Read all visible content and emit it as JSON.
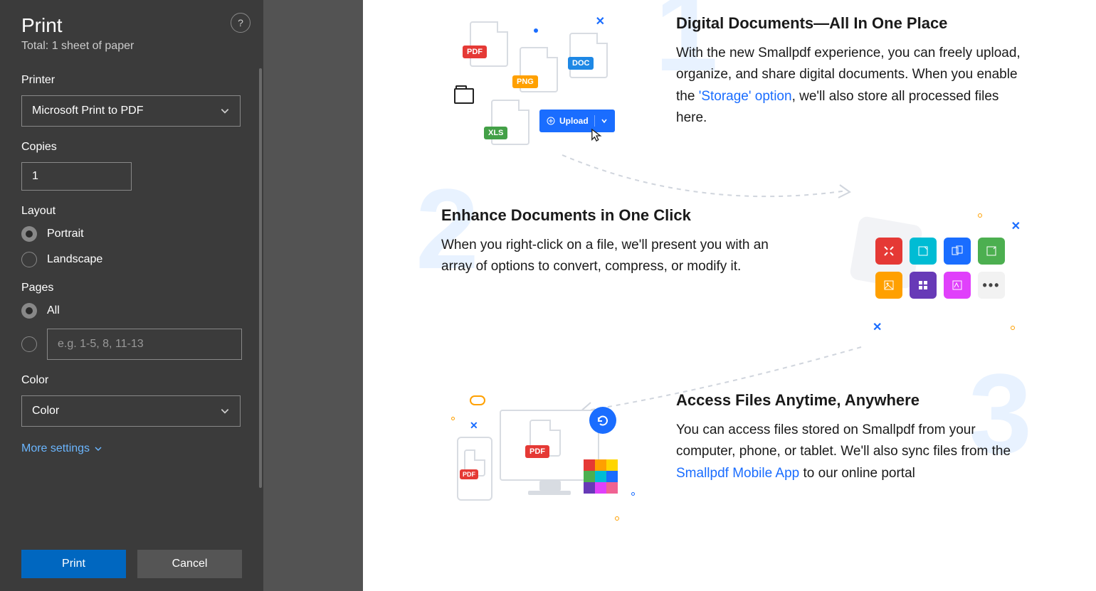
{
  "print": {
    "title": "Print",
    "subtitle": "Total: 1 sheet of paper",
    "help": "?",
    "printer_label": "Printer",
    "printer_value": "Microsoft Print to PDF",
    "copies_label": "Copies",
    "copies_value": "1",
    "layout_label": "Layout",
    "layout_portrait": "Portrait",
    "layout_landscape": "Landscape",
    "pages_label": "Pages",
    "pages_all": "All",
    "pages_placeholder": "e.g. 1-5, 8, 11-13",
    "color_label": "Color",
    "color_value": "Color",
    "more_settings": "More settings",
    "print_btn": "Print",
    "cancel_btn": "Cancel"
  },
  "features": {
    "f1": {
      "title": "Digital Documents—All In One Place",
      "text_a": "With the new Smallpdf experience, you can freely upload, organize, and share digital documents. When you enable the ",
      "link": "'Storage' option",
      "text_b": ", we'll also store all processed files here."
    },
    "f2": {
      "title": "Enhance Documents in One Click",
      "text": "When you right-click on a file, we'll present you with an array of options to convert, compress, or modify it."
    },
    "f3": {
      "title": "Access Files Anytime, Anywhere",
      "text_a": "You can access files stored on Smallpdf from your computer, phone, or tablet. We'll also sync files from the ",
      "link": "Smallpdf Mobile App",
      "text_b": " to our online portal"
    }
  },
  "illus": {
    "pdf": "PDF",
    "png": "PNG",
    "doc": "DOC",
    "xls": "XLS",
    "upload": "Upload"
  },
  "numbers": {
    "n1": "1",
    "n2": "2",
    "n3": "3"
  }
}
